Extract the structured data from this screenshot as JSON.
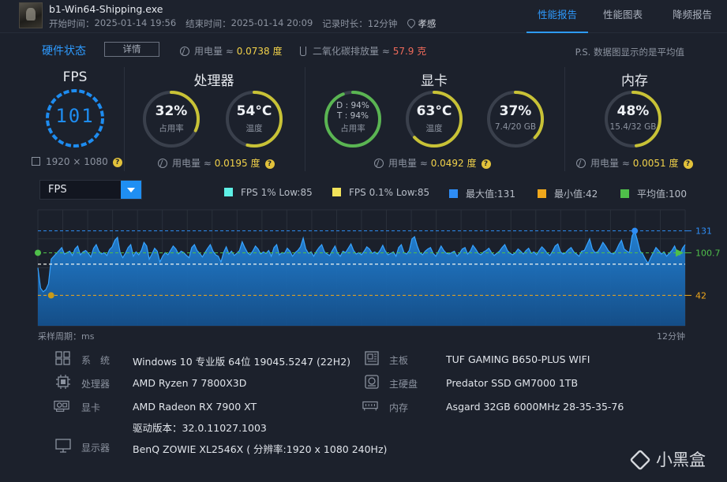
{
  "header": {
    "process_name": "b1-Win64-Shipping.exe",
    "start_label": "开始时间：",
    "start_time": "2025-01-14 19:56",
    "end_label": "结束时间：",
    "end_time": "2025-01-14 20:09",
    "duration_label": "记录时长：",
    "duration": "12分钟",
    "location": "孝感",
    "tabs": [
      {
        "label": "性能报告",
        "active": true
      },
      {
        "label": "性能图表",
        "active": false
      },
      {
        "label": "降频报告",
        "active": false
      }
    ]
  },
  "hardware": {
    "title": "硬件状态",
    "detail_button": "详情",
    "power_label": "用电量 ≈ ",
    "power_value": "0.0738 度",
    "co2_label": "二氧化碳排放量 ≈ ",
    "co2_value": "57.9 克",
    "note": "P.S. 数据图显示的是平均值"
  },
  "fps": {
    "title": "FPS",
    "value": "101",
    "resolution": "1920 × 1080"
  },
  "cpu": {
    "title": "处理器",
    "usage": {
      "value": "32%",
      "label": "占用率",
      "fraction": 0.32,
      "color": "#c8c236"
    },
    "temp": {
      "value": "54°C",
      "label": "温度",
      "fraction": 0.54,
      "color": "#c8c236"
    },
    "power_label": "用电量 ≈ ",
    "power_value": "0.0195 度"
  },
  "gpu": {
    "title": "显卡",
    "usage": {
      "d": "D : 94%",
      "t": "T : 94%",
      "label": "占用率",
      "fraction": 0.94,
      "color": "#5ab552"
    },
    "temp": {
      "value": "63°C",
      "label": "温度",
      "fraction": 0.63,
      "color": "#c8c236"
    },
    "vram": {
      "value": "37%",
      "label": "7.4/20 GB",
      "fraction": 0.37,
      "color": "#c8c236"
    },
    "power_label": "用电量 ≈ ",
    "power_value": "0.0492 度"
  },
  "memory": {
    "title": "内存",
    "usage": {
      "value": "48%",
      "label": "15.4/32 GB",
      "fraction": 0.48,
      "color": "#c8c236"
    },
    "power_label": "用电量 ≈ ",
    "power_value": "0.0051 度"
  },
  "chart_controls": {
    "selected_metric": "FPS",
    "legend": [
      {
        "label": "FPS 1% Low:85",
        "color": "#5ef0e6"
      },
      {
        "label": "FPS 0.1% Low:85",
        "color": "#f2e35a"
      },
      {
        "label": "最大值:131",
        "color": "#2e8df5"
      },
      {
        "label": "最小值:42",
        "color": "#f0a81c"
      },
      {
        "label": "平均值:100",
        "color": "#4fbf4a"
      }
    ],
    "sample_period": "采样周期：ms",
    "duration_end": "12分钟"
  },
  "chart_data": {
    "type": "area",
    "xlabel": "采样周期：ms",
    "x_end_label": "12分钟",
    "y_tick_labels": [
      "131",
      "100.7",
      "42"
    ],
    "ylim": [
      0,
      160
    ],
    "max": 131,
    "min": 42,
    "avg": 100.7,
    "low_1pct": 85,
    "low_01pct": 85,
    "series": [
      {
        "values": [
          80,
          52,
          47,
          50,
          58,
          92,
          96,
          100,
          104,
          108,
          99,
          101,
          103,
          97,
          106,
          110,
          98,
          102,
          104,
          100,
          95,
          107,
          112,
          103,
          99,
          101,
          97,
          105,
          109,
          118,
          122,
          101,
          94,
          100,
          108,
          112,
          96,
          102,
          98,
          104,
          115,
          110,
          92,
          99,
          107,
          103,
          88,
          96,
          101,
          98,
          104,
          110,
          106,
          99,
          103,
          101,
          97,
          94,
          108,
          112,
          104,
          100,
          95,
          101,
          107,
          112,
          103,
          98,
          96,
          88,
          101,
          109,
          99,
          103,
          97,
          100,
          104,
          116,
          108,
          101,
          98,
          103,
          110,
          106,
          99,
          102,
          100,
          104,
          96,
          108,
          112,
          98,
          101,
          100,
          107,
          103,
          96,
          101,
          104,
          109,
          121,
          106,
          100,
          102,
          96,
          103,
          108,
          112,
          102,
          99,
          97,
          104,
          110,
          100,
          96,
          103,
          101,
          107,
          113,
          104,
          99,
          101,
          98,
          103,
          109,
          106,
          100,
          102,
          99,
          104,
          111,
          103,
          98,
          100,
          102,
          96,
          108,
          112,
          101,
          99,
          104,
          120,
          123,
          110,
          101,
          98,
          103,
          106,
          108,
          100,
          96,
          103,
          110,
          104,
          100,
          99,
          101,
          103,
          96,
          100,
          106,
          108,
          99,
          103,
          111,
          106,
          100,
          98,
          102,
          104,
          107,
          101,
          97,
          100,
          103,
          108,
          112,
          104,
          100,
          98,
          101,
          106,
          103,
          99,
          104,
          107,
          100,
          102,
          98,
          104,
          109,
          105,
          100,
          97,
          103,
          110,
          113,
          102,
          99,
          101,
          105,
          108,
          102,
          99,
          96,
          103,
          104,
          112,
          120,
          106,
          101,
          102,
          108,
          115,
          110,
          104,
          100,
          99,
          104,
          112,
          118,
          106,
          103,
          101,
          124,
          131,
          118,
          103,
          99,
          92,
          86,
          94,
          101,
          108,
          104,
          99,
          102,
          96,
          100,
          104,
          110,
          101,
          98,
          107,
          112
        ]
      }
    ]
  },
  "specs": {
    "os": {
      "label": "系　统",
      "value": "Windows 10 专业版 64位 19045.5247 (22H2)"
    },
    "cpu": {
      "label": "处理器",
      "value": "AMD Ryzen 7 7800X3D"
    },
    "gpu": {
      "label": "显卡",
      "value": "AMD Radeon RX 7900 XT",
      "driver": "驱动版本：32.0.11027.1003"
    },
    "monitor": {
      "label": "显示器",
      "value": "BenQ ZOWIE XL2546X ( 分辨率:1920 x 1080 240Hz)"
    },
    "motherboard": {
      "label": "主板",
      "value": "TUF GAMING B650-PLUS WIFI"
    },
    "disk": {
      "label": "主硬盘",
      "value": "Predator SSD GM7000 1TB"
    },
    "ram": {
      "label": "内存",
      "value": "Asgard 32GB 6000MHz 28-35-35-76"
    }
  },
  "watermark": "小黑盒"
}
